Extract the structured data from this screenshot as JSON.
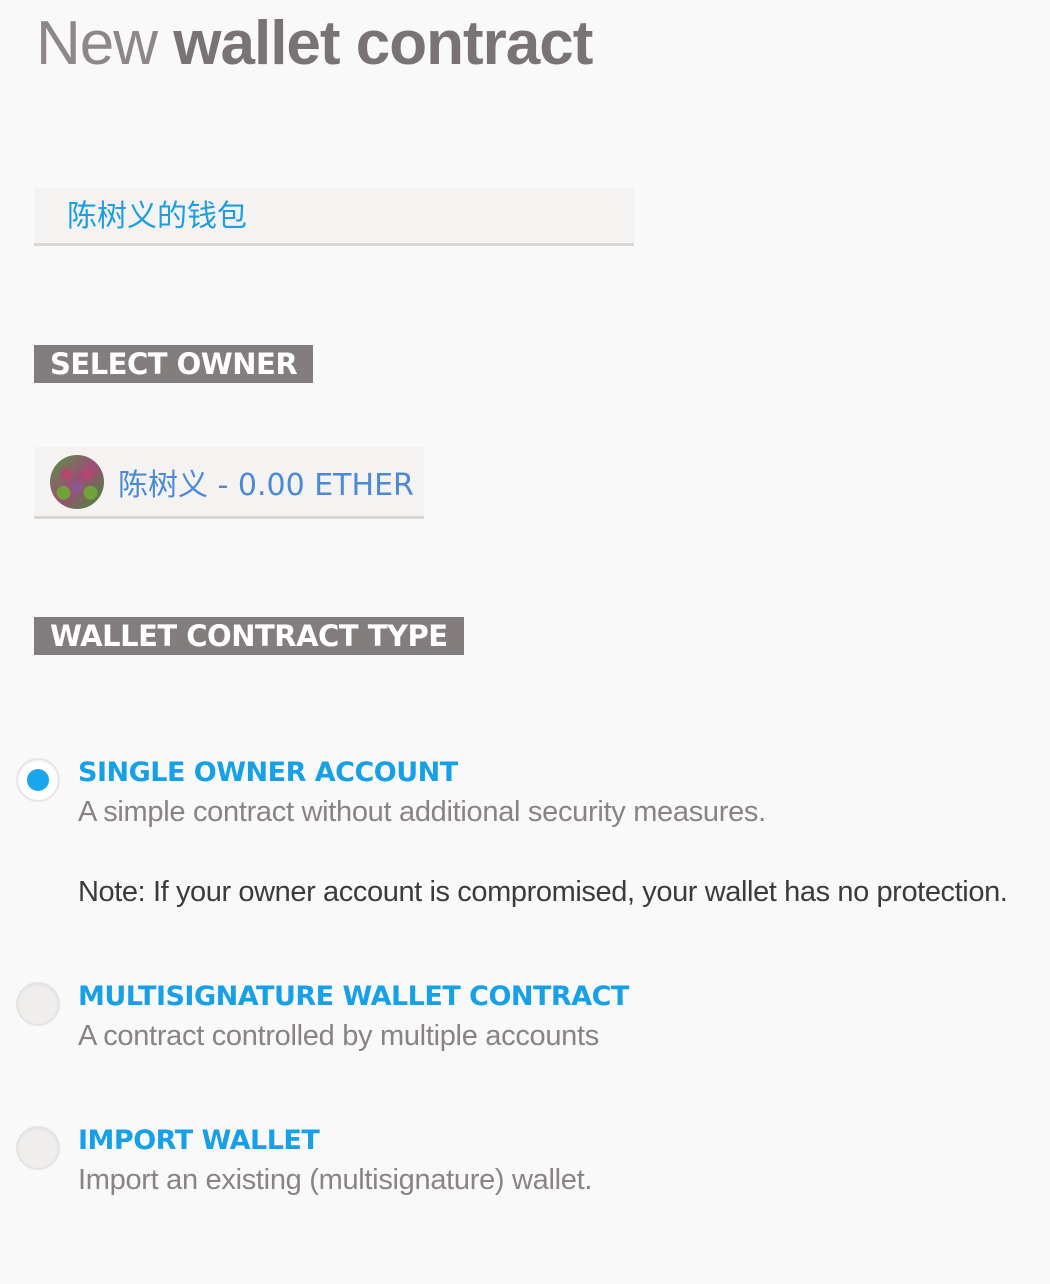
{
  "title": {
    "light": "New ",
    "bold": "wallet contract"
  },
  "name_field": {
    "value": "陈树义的钱包"
  },
  "select_owner": {
    "label": "SELECT OWNER",
    "selected": "陈树义 - 0.00 ETHER"
  },
  "wallet_type": {
    "label": "WALLET CONTRACT TYPE",
    "options": [
      {
        "title": "SINGLE OWNER ACCOUNT",
        "description": "A simple contract without additional security measures.",
        "note": "Note: If your owner account is compromised, your wallet has no protection.",
        "selected": true
      },
      {
        "title": "MULTISIGNATURE WALLET CONTRACT",
        "description": "A contract controlled by multiple accounts",
        "selected": false
      },
      {
        "title": "IMPORT WALLET",
        "description": "Import an existing (multisignature) wallet.",
        "selected": false
      }
    ]
  },
  "colors": {
    "accent": "#16a0e8",
    "label_bg": "#847d7d",
    "owner_text": "#4b8ad6"
  }
}
